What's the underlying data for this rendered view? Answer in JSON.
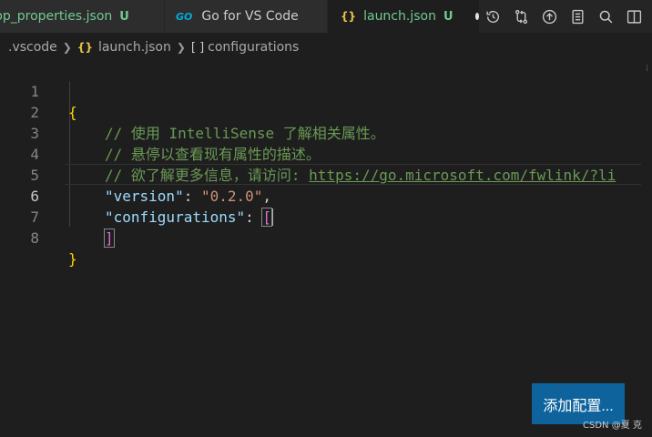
{
  "tabs": [
    {
      "label": "pp_properties.json",
      "badge": "U"
    },
    {
      "label": "Go for VS Code",
      "icon": "go-icon"
    },
    {
      "label": "launch.json",
      "badge": "U",
      "icon": "json-braces-icon"
    }
  ],
  "toolbar_icons": [
    "history-icon",
    "compare-changes-icon",
    "upload-icon",
    "open-preview-icon",
    "search-icon",
    "split-editor-icon"
  ],
  "breadcrumb": {
    "folder": ".vscode",
    "file_icon": "{}",
    "file": "launch.json",
    "node_icon": "[ ]",
    "node": "configurations"
  },
  "editor": {
    "line_numbers": [
      "1",
      "2",
      "3",
      "4",
      "5",
      "6",
      "7",
      "8"
    ],
    "active_line": "6",
    "lines": {
      "l1": "{",
      "l2": "// 使用 IntelliSense 了解相关属性。",
      "l3": "// 悬停以查看现有属性的描述。",
      "l4_prefix": "// 欲了解更多信息，请访问: ",
      "l4_link": "https://go.microsoft.com/fwlink/?li",
      "l5_key": "\"version\"",
      "l5_colon": ": ",
      "l5_value": "\"0.2.0\"",
      "l5_comma": ",",
      "l6_key": "\"configurations\"",
      "l6_colon": ": ",
      "l6_bracket": "[",
      "l7": "]",
      "l8": "}"
    }
  },
  "add_config_button": "添加配置...",
  "watermark": "CSDN @夏 克",
  "colors": {
    "background": "#1e1e1e",
    "untracked_green": "#73c991",
    "comment": "#6a9955",
    "key": "#9cdcfe",
    "string": "#ce9178",
    "brace": "#ffd700",
    "bracket": "#da70d6",
    "button": "#0e639c"
  }
}
